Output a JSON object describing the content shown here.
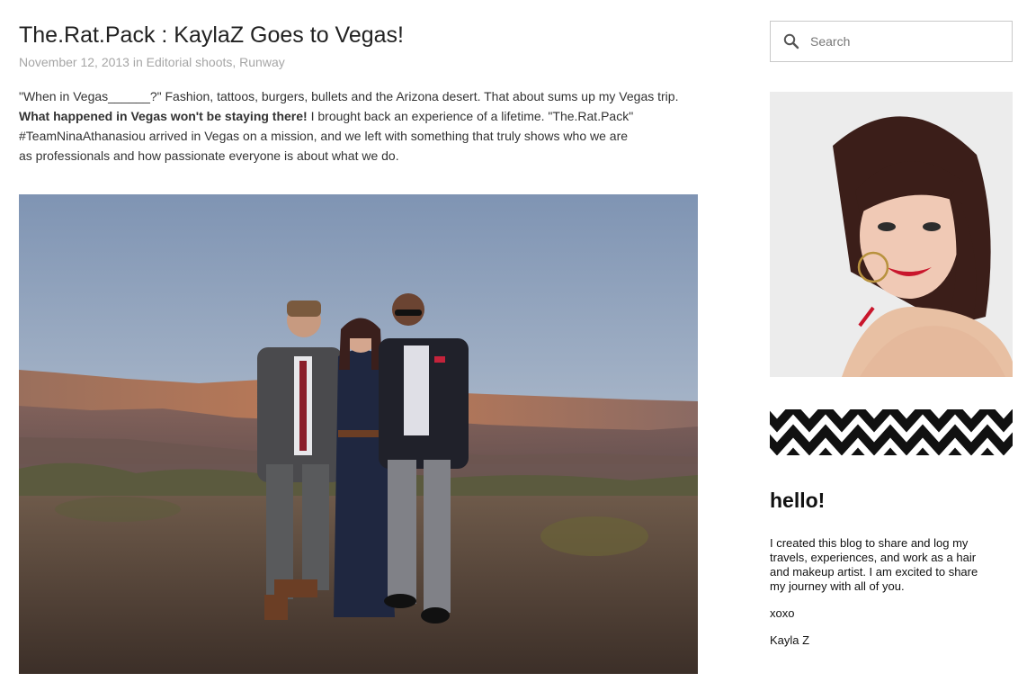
{
  "post": {
    "title": "The.Rat.Pack : KaylaZ Goes to Vegas!",
    "date": "November 12, 2013",
    "in_text": " in ",
    "categories": [
      "Editorial shoots",
      "Runway"
    ],
    "category_separator": ", ",
    "body": {
      "line1": "\"When in Vegas______?\" Fashion, tattoos, burgers, bullets and the Arizona desert.  That about sums up my Vegas trip.",
      "line2_bold": "What happened in Vegas won't be staying there!",
      "line2_rest": "  I brought back an experience of a lifetime.  \"The.Rat.Pack\"",
      "line3": "#TeamNinaAthanasiou arrived in Vegas on a mission, and we left with something that truly shows who we are",
      "line4": "as professionals and how passionate everyone is about what we do."
    }
  },
  "sidebar": {
    "search": {
      "placeholder": "Search",
      "value": ""
    },
    "about": {
      "title": "hello!",
      "lines": [
        "I created this blog to share and log my",
        "travels, experiences, and work as a hair",
        "and makeup artist. I am excited to share",
        "my journey with all of you."
      ],
      "xoxo": "xoxo",
      "signature": "Kayla Z"
    }
  },
  "colors": {
    "title": "#222222",
    "meta": "#a6a6a6",
    "body_text": "#333333",
    "search_border": "#c9c9c9",
    "chevron": "#111111"
  },
  "icons": {
    "search": "magnifier"
  }
}
